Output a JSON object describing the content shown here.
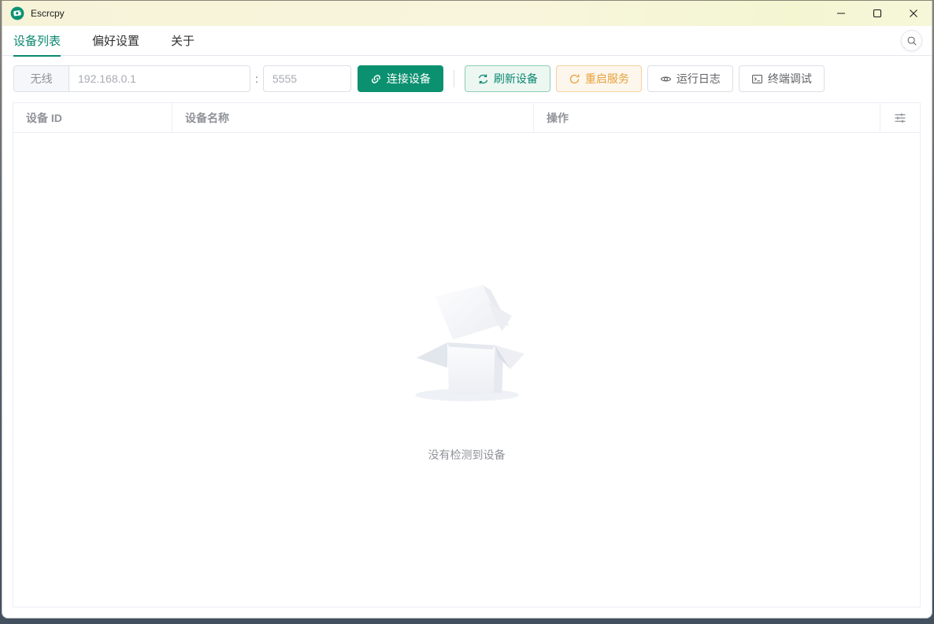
{
  "window": {
    "title": "Escrcpy",
    "controls": {
      "minimize": "minimize",
      "maximize": "maximize",
      "close": "close"
    }
  },
  "tabs": [
    {
      "label": "设备列表",
      "active": true
    },
    {
      "label": "偏好设置",
      "active": false
    },
    {
      "label": "关于",
      "active": false
    }
  ],
  "search": {
    "icon": "search-icon"
  },
  "toolbar": {
    "mode_label": "无线",
    "ip_input": {
      "value": "",
      "placeholder": "192.168.0.1"
    },
    "separator": ":",
    "port_input": {
      "value": "",
      "placeholder": "5555"
    },
    "connect_button": "连接设备",
    "refresh_button": "刷新设备",
    "restart_button": "重启服务",
    "logs_button": "运行日志",
    "terminal_button": "终端调试"
  },
  "table": {
    "columns": [
      "设备 ID",
      "设备名称",
      "操作"
    ]
  },
  "empty": {
    "text": "没有检测到设备"
  },
  "icons": {
    "app_logo": "escrcpy-logo",
    "search": "magnifier",
    "connect": "link",
    "refresh": "refresh-arrows",
    "restart": "refresh-right-arrow",
    "logs": "eye",
    "terminal": "terminal-window",
    "column_settings": "sliders",
    "minimize": "–",
    "maximize": "□",
    "close": "×"
  },
  "colors": {
    "titlebar_bg": "#f7f4d9",
    "accent": "#0b8770",
    "connect_button_bg": "#0c9170",
    "warning": "#e6a23c",
    "input_border": "#dcdfe6",
    "table_border": "#ebeef5",
    "header_text": "#909399",
    "placeholder_text": "#a8abb2",
    "body_text": "#606266"
  }
}
